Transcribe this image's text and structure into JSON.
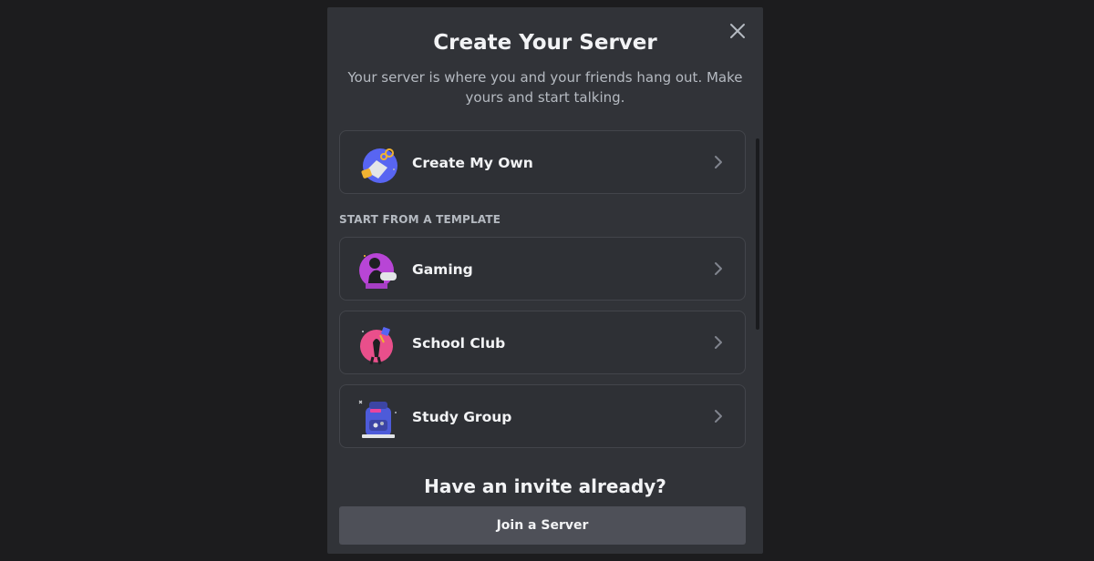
{
  "modal": {
    "title": "Create Your Server",
    "subtitle": "Your server is where you and your friends hang out. Make yours and start talking.",
    "close_icon": "close-icon"
  },
  "create_own": {
    "label": "Create My Own",
    "icon": "create-server-icon"
  },
  "templates": {
    "header": "START FROM A TEMPLATE",
    "items": [
      {
        "label": "Gaming",
        "icon": "gaming-icon"
      },
      {
        "label": "School Club",
        "icon": "school-club-icon"
      },
      {
        "label": "Study Group",
        "icon": "study-group-icon"
      }
    ]
  },
  "footer": {
    "title": "Have an invite already?",
    "join_label": "Join a Server"
  },
  "colors": {
    "background": "#1c1c1e",
    "modal": "#313338",
    "option_border": "#43454b",
    "text_primary": "#f2f3f5",
    "text_secondary": "#b5bac1",
    "button": "#4e5058"
  }
}
